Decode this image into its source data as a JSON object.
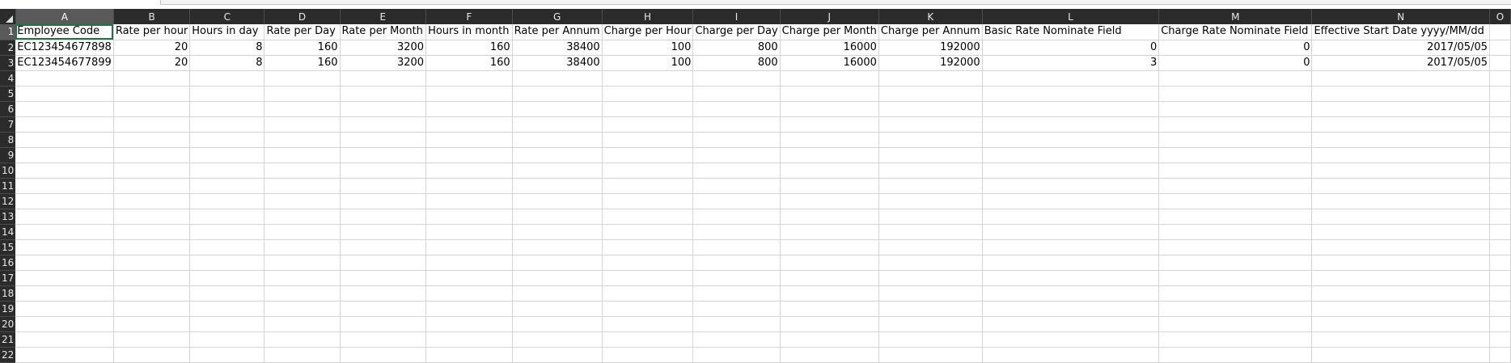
{
  "columns": [
    "A",
    "B",
    "C",
    "D",
    "E",
    "F",
    "G",
    "H",
    "I",
    "J",
    "K",
    "L",
    "M",
    "N",
    "O"
  ],
  "rows": [
    {
      "num": "1",
      "cells": [
        "Employee Code",
        "Rate per hour",
        "Hours in day",
        "Rate per Day",
        "Rate per Month",
        "Hours in month",
        "Rate per Annum",
        "Charge per Hour",
        "Charge per Day",
        "Charge per Month",
        "Charge per Annum",
        "Basic Rate Nominate Field",
        "Charge Rate Nominate Field",
        "Effective Start Date yyyy/MM/dd",
        ""
      ]
    },
    {
      "num": "2",
      "cells": [
        "EC123454677898",
        "20",
        "8",
        "160",
        "3200",
        "160",
        "38400",
        "100",
        "800",
        "16000",
        "192000",
        "0",
        "0",
        "2017/05/05",
        ""
      ]
    },
    {
      "num": "3",
      "cells": [
        "EC123454677899",
        "20",
        "8",
        "160",
        "3200",
        "160",
        "38400",
        "100",
        "800",
        "16000",
        "192000",
        "3",
        "0",
        "2017/05/05",
        ""
      ]
    },
    {
      "num": "4",
      "cells": [
        "",
        "",
        "",
        "",
        "",
        "",
        "",
        "",
        "",
        "",
        "",
        "",
        "",
        "",
        ""
      ]
    },
    {
      "num": "5",
      "cells": [
        "",
        "",
        "",
        "",
        "",
        "",
        "",
        "",
        "",
        "",
        "",
        "",
        "",
        "",
        ""
      ]
    },
    {
      "num": "6",
      "cells": [
        "",
        "",
        "",
        "",
        "",
        "",
        "",
        "",
        "",
        "",
        "",
        "",
        "",
        "",
        ""
      ]
    },
    {
      "num": "7",
      "cells": [
        "",
        "",
        "",
        "",
        "",
        "",
        "",
        "",
        "",
        "",
        "",
        "",
        "",
        "",
        ""
      ]
    },
    {
      "num": "8",
      "cells": [
        "",
        "",
        "",
        "",
        "",
        "",
        "",
        "",
        "",
        "",
        "",
        "",
        "",
        "",
        ""
      ]
    },
    {
      "num": "9",
      "cells": [
        "",
        "",
        "",
        "",
        "",
        "",
        "",
        "",
        "",
        "",
        "",
        "",
        "",
        "",
        ""
      ]
    },
    {
      "num": "10",
      "cells": [
        "",
        "",
        "",
        "",
        "",
        "",
        "",
        "",
        "",
        "",
        "",
        "",
        "",
        "",
        ""
      ]
    },
    {
      "num": "11",
      "cells": [
        "",
        "",
        "",
        "",
        "",
        "",
        "",
        "",
        "",
        "",
        "",
        "",
        "",
        "",
        ""
      ]
    },
    {
      "num": "12",
      "cells": [
        "",
        "",
        "",
        "",
        "",
        "",
        "",
        "",
        "",
        "",
        "",
        "",
        "",
        "",
        ""
      ]
    },
    {
      "num": "13",
      "cells": [
        "",
        "",
        "",
        "",
        "",
        "",
        "",
        "",
        "",
        "",
        "",
        "",
        "",
        "",
        ""
      ]
    },
    {
      "num": "14",
      "cells": [
        "",
        "",
        "",
        "",
        "",
        "",
        "",
        "",
        "",
        "",
        "",
        "",
        "",
        "",
        ""
      ]
    },
    {
      "num": "15",
      "cells": [
        "",
        "",
        "",
        "",
        "",
        "",
        "",
        "",
        "",
        "",
        "",
        "",
        "",
        "",
        ""
      ]
    },
    {
      "num": "16",
      "cells": [
        "",
        "",
        "",
        "",
        "",
        "",
        "",
        "",
        "",
        "",
        "",
        "",
        "",
        "",
        ""
      ]
    },
    {
      "num": "17",
      "cells": [
        "",
        "",
        "",
        "",
        "",
        "",
        "",
        "",
        "",
        "",
        "",
        "",
        "",
        "",
        ""
      ]
    },
    {
      "num": "18",
      "cells": [
        "",
        "",
        "",
        "",
        "",
        "",
        "",
        "",
        "",
        "",
        "",
        "",
        "",
        "",
        ""
      ]
    },
    {
      "num": "19",
      "cells": [
        "",
        "",
        "",
        "",
        "",
        "",
        "",
        "",
        "",
        "",
        "",
        "",
        "",
        "",
        ""
      ]
    },
    {
      "num": "20",
      "cells": [
        "",
        "",
        "",
        "",
        "",
        "",
        "",
        "",
        "",
        "",
        "",
        "",
        "",
        "",
        ""
      ]
    },
    {
      "num": "21",
      "cells": [
        "",
        "",
        "",
        "",
        "",
        "",
        "",
        "",
        "",
        "",
        "",
        "",
        "",
        "",
        ""
      ]
    },
    {
      "num": "22",
      "cells": [
        "",
        "",
        "",
        "",
        "",
        "",
        "",
        "",
        "",
        "",
        "",
        "",
        "",
        "",
        ""
      ]
    }
  ],
  "active_column": "A",
  "active_row": "1",
  "colors": {
    "header_bg": "#2b2b2b",
    "header_active": "#5a5a5a",
    "gridline": "#d4d4d4",
    "selection": "#217346"
  }
}
